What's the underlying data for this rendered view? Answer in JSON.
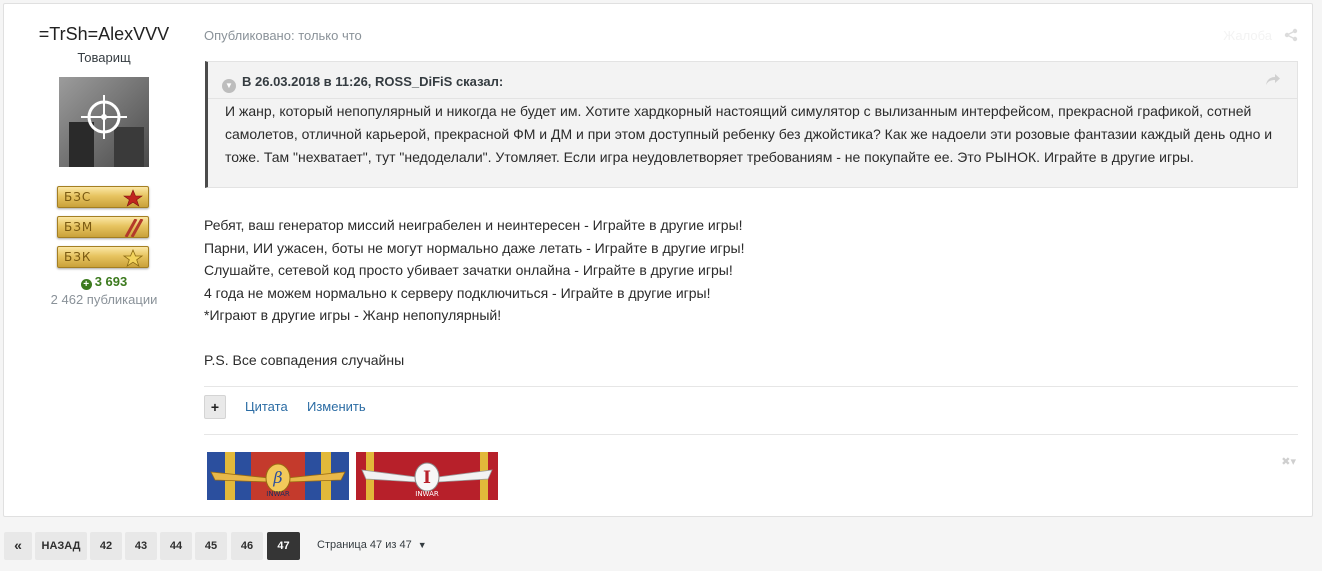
{
  "author": {
    "name": "=TrSh=AlexVVV",
    "title": "Товарищ",
    "badges": [
      "БЗС",
      "БЗМ",
      "БЗК"
    ],
    "reputation": "3 693",
    "posts": "2 462 публикации"
  },
  "post": {
    "published": "Опубликовано: только что",
    "report_label": "Жалоба",
    "quote": {
      "header": "В 26.03.2018 в 11:26, ROSS_DiFiS сказал:",
      "text": " И жанр, который непопулярный и никогда не будет им. Хотите хардкорный настоящий симулятор с вылизанным интерфейсом, прекрасной графикой, сотней самолетов, отличной карьерой, прекрасной ФМ и ДМ и при этом доступный ребенку без джойстика? Как же надоели эти розовые фантазии каждый день одно и тоже. Там \"нехватает\", тут \"недоделали\". Утомляет. Если игра неудовлетворяет требованиям - не покупайте ее. Это РЫНОК. Играйте в другие игры."
    },
    "lines": [
      "Ребят, ваш генератор миссий неиграбелен и неинтересен - Играйте в другие игры!",
      "Парни, ИИ ужасен, боты не могут нормально даже летать - Играйте в другие игры!",
      "Слушайте, сетевой код просто убивает зачатки онлайна - Играйте в другие игры!",
      "4 года не можем нормально к серверу подключиться - Играйте в другие игры!",
      "*Играют в другие игры - Жанр непопулярный!",
      "",
      "P.S. Все совпадения случайны"
    ],
    "actions": {
      "plus": "+",
      "quote": "Цитата",
      "edit": "Изменить"
    },
    "signature": {
      "ribbon1_text": "INWAR",
      "ribbon1_symbol": "β",
      "ribbon2_text": "INWAR",
      "ribbon2_symbol": "I"
    }
  },
  "pagination": {
    "first": "«",
    "back": "НАЗАД",
    "pages": [
      "42",
      "43",
      "44",
      "45",
      "46",
      "47"
    ],
    "current": "47",
    "info": "Страница 47 из 47"
  },
  "colors": {
    "link": "#2b6ca4",
    "rep": "#3c7a1e",
    "active_page": "#353535"
  }
}
